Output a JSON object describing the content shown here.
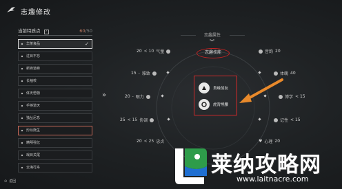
{
  "header": {
    "title": "志趣修改"
  },
  "left_panel": {
    "heading": "当前特质点",
    "help": "?",
    "points_used": "60",
    "points_total": "/50",
    "items": [
      {
        "label": "华茶良品",
        "state": "selected"
      },
      {
        "label": "过目不忘",
        "state": "normal"
      },
      {
        "label": "新锋道峰",
        "state": "normal"
      },
      {
        "label": "长袖校",
        "state": "normal"
      },
      {
        "label": "体天悟物",
        "state": "normal"
      },
      {
        "label": "手够道天",
        "state": "normal"
      },
      {
        "label": "独丛尼息",
        "state": "normal"
      },
      {
        "label": "形似熊生",
        "state": "highlighted"
      },
      {
        "label": "精明强亿",
        "state": "normal"
      },
      {
        "label": "戏目关尾",
        "state": "normal"
      },
      {
        "label": "云海行舟",
        "state": "normal"
      }
    ]
  },
  "attributes": {
    "title": "志趣属性",
    "skill_button": "志趣技能",
    "stats_left": [
      {
        "prefix": "20",
        "mod": "< 10",
        "label": "气量"
      },
      {
        "prefix": "15",
        "mod": "",
        "label": "雅致"
      },
      {
        "prefix": "20",
        "mod": "",
        "label": "眼力"
      },
      {
        "prefix": "25",
        "mod": "< 15",
        "label": "协调"
      },
      {
        "prefix": "20",
        "mod": "< 25",
        "label": "忠贞"
      }
    ],
    "stats_right": [
      {
        "label": "音韵",
        "value": "20"
      },
      {
        "label": "体魄",
        "value": "40"
      },
      {
        "label": "博学",
        "value": "< 15"
      },
      {
        "label": "记性",
        "value": "< 15"
      },
      {
        "label": "心理",
        "value": "20"
      }
    ],
    "skills": [
      {
        "label": "良缘加友"
      },
      {
        "label": "虎背熊腰"
      }
    ]
  },
  "bottom": {
    "label": "返回"
  },
  "brand": {
    "name": "莱纳攻略网",
    "url": "www.laitnacre.com"
  }
}
